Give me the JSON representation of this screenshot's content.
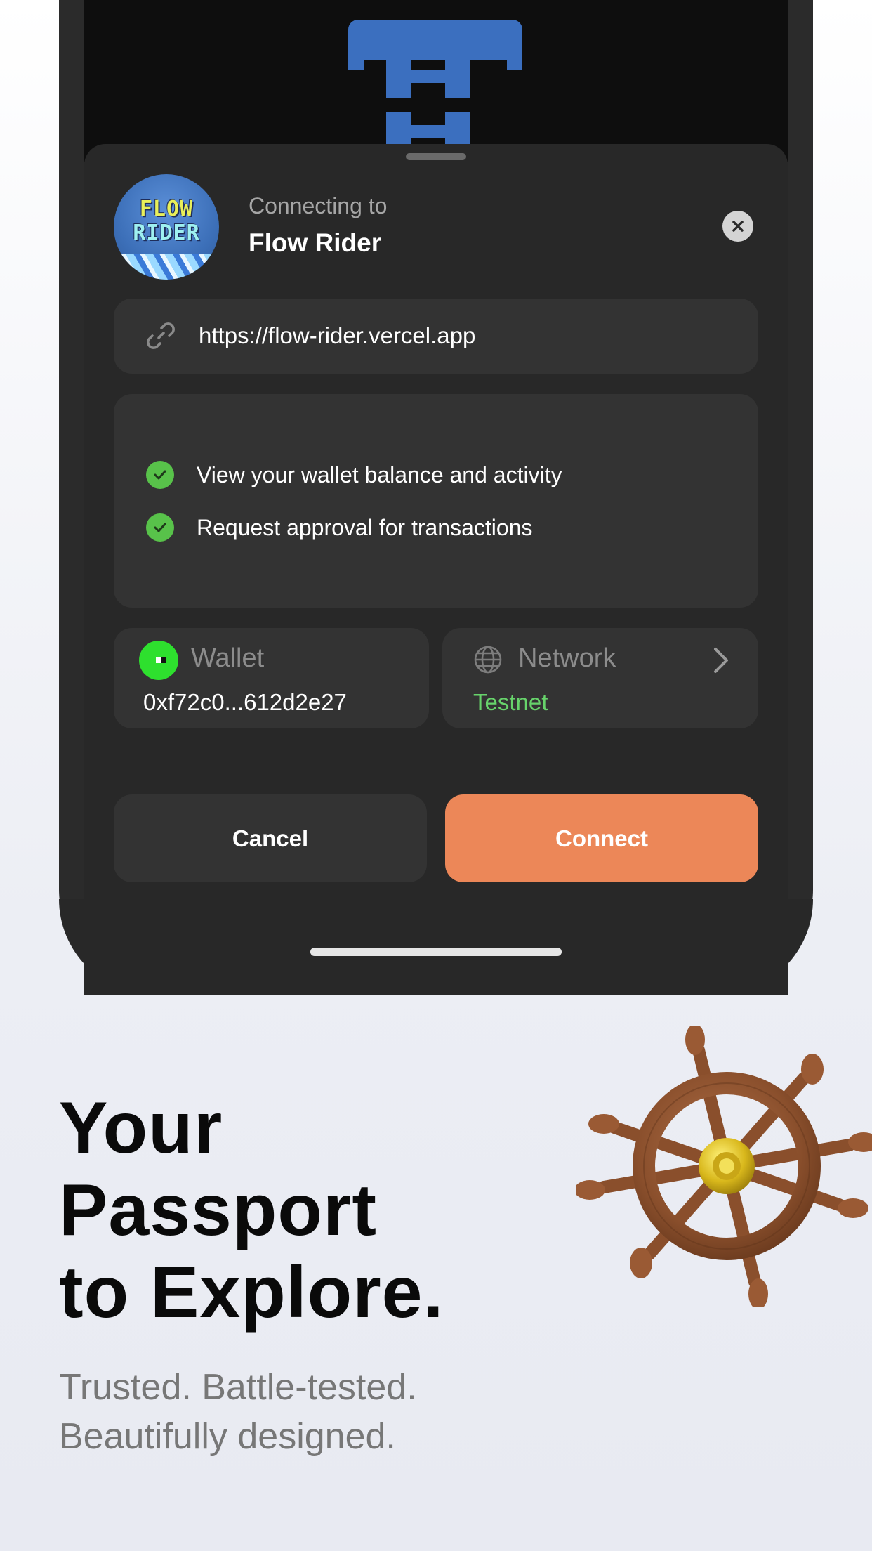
{
  "connect_sheet": {
    "connecting_label": "Connecting to",
    "app_name": "Flow Rider",
    "app_logo_text": [
      "FLOW",
      "RIDER"
    ],
    "url": "https://flow-rider.vercel.app",
    "permissions": [
      "View your wallet balance and activity",
      "Request approval for transactions"
    ],
    "wallet": {
      "label": "Wallet",
      "address": "0xf72c0...612d2e27"
    },
    "network": {
      "label": "Network",
      "value": "Testnet"
    },
    "buttons": {
      "cancel": "Cancel",
      "connect": "Connect"
    }
  },
  "promo": {
    "headline": [
      "Your",
      "Passport",
      "to Explore."
    ],
    "subtitle": [
      "Trusted. Battle-tested.",
      "Beautifully designed."
    ]
  },
  "colors": {
    "connect_accent": "#ec8758",
    "network_status": "#67d36b",
    "check_green": "#58c24a",
    "wallet_icon_green": "#2ee02e"
  },
  "icons": [
    "close-icon",
    "link-icon",
    "check-icon",
    "wallet-icon",
    "globe-icon",
    "chevron-right-icon",
    "ship-wheel-icon"
  ]
}
